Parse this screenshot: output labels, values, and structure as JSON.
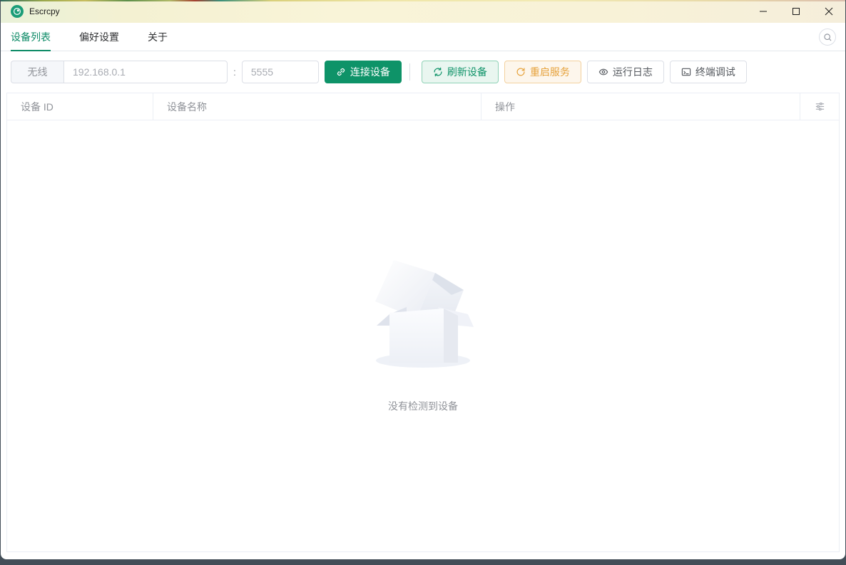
{
  "window": {
    "title": "Escrcpy",
    "controls": [
      {
        "name": "minimize"
      },
      {
        "name": "maximize"
      },
      {
        "name": "close"
      }
    ]
  },
  "tabs": [
    {
      "label": "设备列表",
      "active": true
    },
    {
      "label": "偏好设置",
      "active": false
    },
    {
      "label": "关于",
      "active": false
    }
  ],
  "toolbar": {
    "mode_label": "无线",
    "ip_placeholder": "192.168.0.1",
    "port_separator": ":",
    "port_placeholder": "5555",
    "connect_label": "连接设备",
    "refresh_label": "刷新设备",
    "restart_label": "重启服务",
    "logs_label": "运行日志",
    "terminal_label": "终端调试"
  },
  "table": {
    "columns": [
      "设备 ID",
      "设备名称",
      "操作"
    ],
    "rows": [],
    "empty_text": "没有检测到设备"
  },
  "icons": {
    "app": "escrcpy-logo",
    "search": "search-icon",
    "connect": "link-icon",
    "refresh": "refresh-icon",
    "restart": "refresh-right-icon",
    "logs": "eye-icon",
    "terminal": "terminal-icon",
    "column_settings": "sliders-icon"
  },
  "colors": {
    "primary": "#0e9368",
    "active_tab": "#0c8a66",
    "warning": "#e6a23c",
    "header_text": "#909399",
    "titlebar_bg": "#f8f2d7",
    "taskbar_bg": "#434e58"
  }
}
